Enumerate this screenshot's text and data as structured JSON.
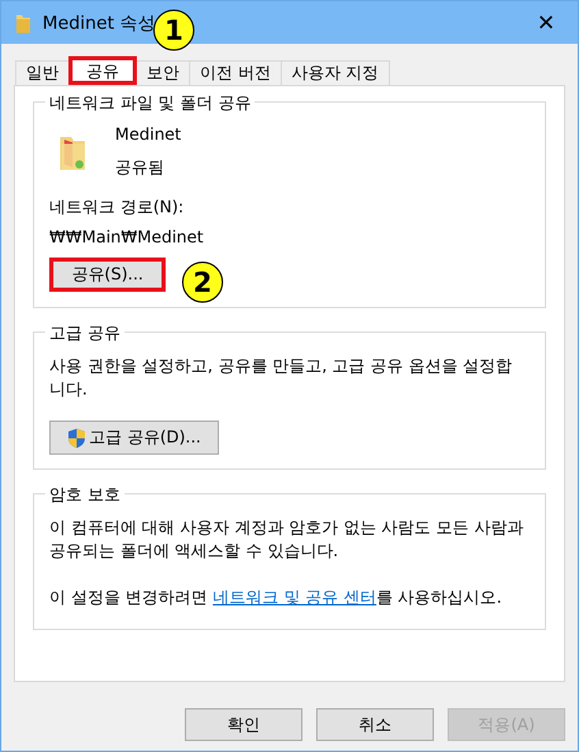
{
  "window": {
    "title": "Medinet 속성",
    "close": "✕"
  },
  "tabs": [
    {
      "label": "일반",
      "selected": false,
      "highlighted": false
    },
    {
      "label": "공유",
      "selected": true,
      "highlighted": true
    },
    {
      "label": "보안",
      "selected": false,
      "highlighted": false
    },
    {
      "label": "이전 버전",
      "selected": false,
      "highlighted": false
    },
    {
      "label": "사용자 지정",
      "selected": false,
      "highlighted": false
    }
  ],
  "network_sharing": {
    "legend": "네트워크 파일 및 폴더 공유",
    "name": "Medinet",
    "status": "공유됨",
    "path_label": "네트워크 경로(N):",
    "path": "₩₩Main₩Medinet",
    "button": {
      "label": "공유(S)...",
      "highlighted": true
    }
  },
  "advanced_sharing": {
    "legend": "고급 공유",
    "description": "사용 권한을 설정하고, 공유를 만들고, 고급 공유 옵션을 설정합니다.",
    "button": {
      "label": "고급 공유(D)...",
      "highlighted": false
    }
  },
  "password_protection": {
    "legend": "암호 보호",
    "description": "이 컴퓨터에 대해 사용자 계정과 암호가 없는 사람도 모든 사람과 공유되는 폴더에 액세스할 수 있습니다.",
    "note_before": "이 설정을 변경하려면 ",
    "link": "네트워크 및 공유 센터",
    "note_after": "를 사용하십시오."
  },
  "buttons": [
    {
      "label": "확인",
      "disabled": false
    },
    {
      "label": "취소",
      "disabled": false
    },
    {
      "label": "적용(A)",
      "disabled": true
    }
  ],
  "callouts": [
    {
      "number": "1"
    },
    {
      "number": "2"
    }
  ]
}
